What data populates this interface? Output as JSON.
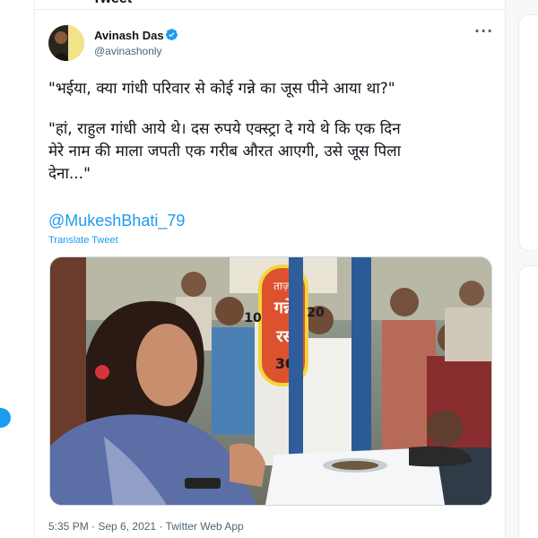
{
  "header": {
    "title": "Tweet"
  },
  "author": {
    "name": "Avinash Das",
    "handle": "@avinashonly",
    "verified_color": "#1d9bf0"
  },
  "tweet": {
    "line1": "\"भईया, क्या गांधी परिवार से कोई गन्ने का जूस पीने आया था?\"",
    "line2": "\"हां, राहुल गांधी आये थे। दस रुपये एक्स्ट्रा दे गये थे कि एक दिन\nमेरे नाम की माला जपती एक गरीब औरत आएगी, उसे जूस पिला\nदेना...\"",
    "mention": "@MukeshBhati_79",
    "translate_label": "Translate Tweet"
  },
  "media": {
    "sign_text_top": "ताज़ा",
    "sign_text_mid": "गन्ने",
    "sign_text_low": "रस",
    "sign_num_left": "10",
    "sign_num_right": "20",
    "sign_num_bottom": "30"
  },
  "meta": {
    "time": "5:35 PM",
    "separator": " · ",
    "date": "Sep 6, 2021",
    "client": "Twitter Web App"
  },
  "colors": {
    "accent": "#1d9bf0",
    "text": "#0f1419",
    "muted": "#536471"
  }
}
